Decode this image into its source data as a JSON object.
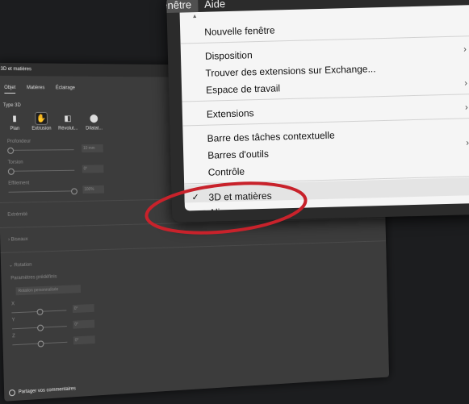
{
  "panel": {
    "title": "3D et matières",
    "tabs": [
      "Objet",
      "Matières",
      "Éclairage"
    ],
    "type_section": "Type 3D",
    "types": [
      "Plan",
      "Extrusion",
      "Révolut...",
      "Dilatat..."
    ],
    "rows": [
      {
        "label": "Profondeur",
        "value": "10 mm"
      },
      {
        "label": "Torsion",
        "value": "0°"
      },
      {
        "label": "Effilement",
        "value": "100%"
      }
    ],
    "extremity": "Extrémité",
    "bevels": "Biseaux",
    "rotation": "Rotation",
    "presets_label": "Paramètres prédéfinis",
    "preset_value": "Rotation personnalisée",
    "axes": [
      {
        "label": "X",
        "value": "0°"
      },
      {
        "label": "Y",
        "value": "0°"
      },
      {
        "label": "Z",
        "value": "0°"
      }
    ],
    "footer": "Partager vos commentaires"
  },
  "menubar": {
    "window": "Fenêtre",
    "help": "Aide"
  },
  "menu": {
    "scroll_up": "▲",
    "items": {
      "new_window": "Nouvelle fenêtre",
      "layout": "Disposition",
      "find_extensions": "Trouver des extensions sur Exchange...",
      "workspace": "Espace de travail",
      "extensions": "Extensions",
      "context_taskbar": "Barre des tâches contextuelle",
      "toolbars": "Barres d'outils",
      "control": "Contrôle",
      "3d_materials": "3D et matières",
      "align": "Aligner"
    },
    "submenu_arrow": "›",
    "check": "✓"
  },
  "colors": {
    "annotation": "#c8222b",
    "menu_bg": "#f5f5f5",
    "panel_bg": "#3c3c3c"
  }
}
